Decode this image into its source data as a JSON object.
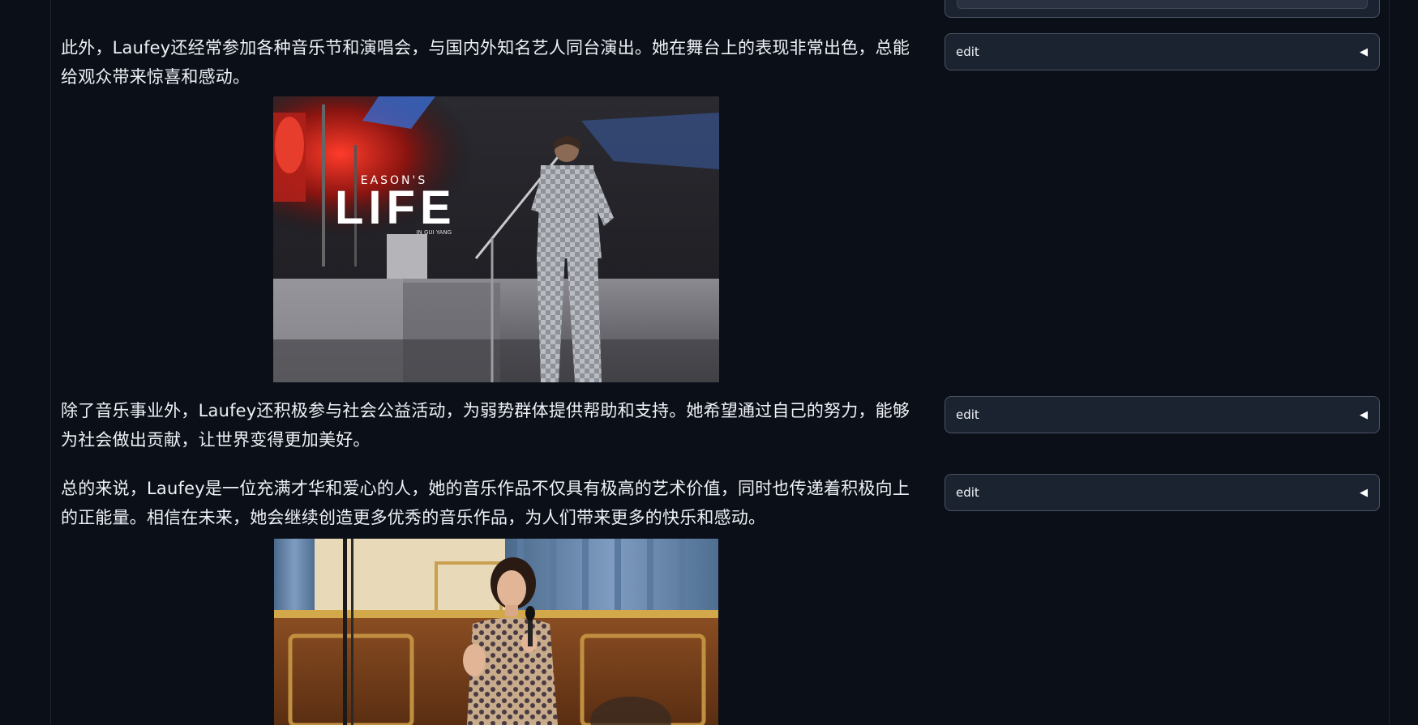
{
  "paragraphs": [
    "此外，Laufey还经常参加各种音乐节和演唱会，与国内外知名艺人同台演出。她在舞台上的表现非常出色，总能给观众带来惊喜和感动。",
    "除了音乐事业外，Laufey还积极参与社会公益活动，为弱势群体提供帮助和支持。她希望通过自己的努力，能够为社会做出贡献，让世界变得更加美好。",
    "总的来说，Laufey是一位充满才华和爱心的人，她的音乐作品不仅具有极高的艺术价值，同时也传递着积极向上的正能量。相信在未来，她会继续创造更多优秀的音乐作品，为人们带来更多的快乐和感动。"
  ],
  "edit_controls": [
    {
      "label": "edit",
      "icon": "triangle-left-icon"
    },
    {
      "label": "edit",
      "icon": "triangle-left-icon"
    },
    {
      "label": "edit",
      "icon": "triangle-left-icon"
    }
  ],
  "images": {
    "concert": {
      "title_small": "EASON'S",
      "title_big": "LIFE",
      "subtitle": "IN GUI YANG"
    }
  },
  "colors": {
    "background": "#0b0f17",
    "panel": "#1c2330",
    "panel_border": "#4a5264"
  }
}
